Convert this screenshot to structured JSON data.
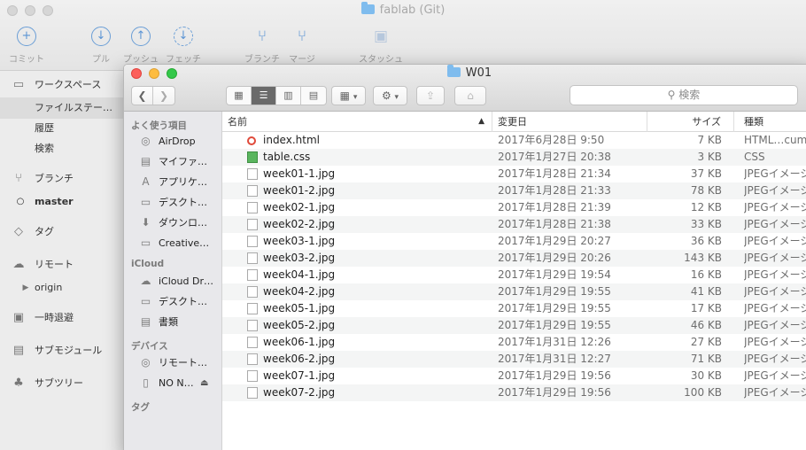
{
  "back_window": {
    "title": "fablab (Git)",
    "toolbar": [
      {
        "label": "コミット",
        "glyph": "+",
        "style": "circ"
      },
      {
        "label": "プル",
        "glyph": "↓",
        "style": "circ"
      },
      {
        "label": "プッシュ",
        "glyph": "↑",
        "style": "circ"
      },
      {
        "label": "フェッチ",
        "glyph": "↓",
        "style": "dash"
      },
      {
        "label": "ブランチ",
        "glyph": "⑂",
        "style": "glyph"
      },
      {
        "label": "マージ",
        "glyph": "⑂",
        "style": "glyph"
      },
      {
        "label": "スタッシュ",
        "glyph": "▣",
        "style": "dim"
      }
    ],
    "sidebar": {
      "workspace": "ワークスペース",
      "file_status": "ファイルステー…",
      "history": "履歴",
      "search": "検索",
      "branches": "ブランチ",
      "master": "master",
      "tags": "タグ",
      "remotes": "リモート",
      "origin": "origin",
      "stashes": "一時退避",
      "submodules": "サブモジュール",
      "subtrees": "サブツリー"
    }
  },
  "finder": {
    "title": "W01",
    "search_placeholder": "検索",
    "sidebar": {
      "favorites_header": "よく使う項目",
      "favorites": [
        {
          "label": "AirDrop",
          "icon": "airdrop-icon",
          "glyph": "◎"
        },
        {
          "label": "マイファ…",
          "icon": "all-files-icon",
          "glyph": "▤"
        },
        {
          "label": "アプリケ…",
          "icon": "applications-icon",
          "glyph": "A"
        },
        {
          "label": "デスクト…",
          "icon": "desktop-icon",
          "glyph": "▭"
        },
        {
          "label": "ダウンロ…",
          "icon": "downloads-icon",
          "glyph": "⬇"
        },
        {
          "label": "Creative…",
          "icon": "folder-icon",
          "glyph": "▭"
        }
      ],
      "icloud_header": "iCloud",
      "icloud": [
        {
          "label": "iCloud Dr…",
          "icon": "cloud-icon",
          "glyph": "☁"
        },
        {
          "label": "デスクト…",
          "icon": "desktop-icon",
          "glyph": "▭"
        },
        {
          "label": "書類",
          "icon": "documents-icon",
          "glyph": "▤"
        }
      ],
      "devices_header": "デバイス",
      "devices": [
        {
          "label": "リモート…",
          "icon": "remote-disc-icon",
          "glyph": "◎"
        },
        {
          "label": "NO N…",
          "icon": "drive-icon",
          "glyph": "▯"
        }
      ],
      "tags_header": "タグ"
    },
    "columns": {
      "name": "名前",
      "modified": "変更日",
      "size": "サイズ",
      "kind": "種類"
    },
    "files": [
      {
        "name": "index.html",
        "modified": "2017年6月28日 9:50",
        "size": "7 KB",
        "kind": "HTML…cument"
      },
      {
        "name": "table.css",
        "modified": "2017年1月27日 20:38",
        "size": "3 KB",
        "kind": "CSS"
      },
      {
        "name": "week01-1.jpg",
        "modified": "2017年1月28日 21:34",
        "size": "37 KB",
        "kind": "JPEGイメージ"
      },
      {
        "name": "week01-2.jpg",
        "modified": "2017年1月28日 21:33",
        "size": "78 KB",
        "kind": "JPEGイメージ"
      },
      {
        "name": "week02-1.jpg",
        "modified": "2017年1月28日 21:39",
        "size": "12 KB",
        "kind": "JPEGイメージ"
      },
      {
        "name": "week02-2.jpg",
        "modified": "2017年1月28日 21:38",
        "size": "33 KB",
        "kind": "JPEGイメージ"
      },
      {
        "name": "week03-1.jpg",
        "modified": "2017年1月29日 20:27",
        "size": "36 KB",
        "kind": "JPEGイメージ"
      },
      {
        "name": "week03-2.jpg",
        "modified": "2017年1月29日 20:26",
        "size": "143 KB",
        "kind": "JPEGイメージ"
      },
      {
        "name": "week04-1.jpg",
        "modified": "2017年1月29日 19:54",
        "size": "16 KB",
        "kind": "JPEGイメージ"
      },
      {
        "name": "week04-2.jpg",
        "modified": "2017年1月29日 19:55",
        "size": "41 KB",
        "kind": "JPEGイメージ"
      },
      {
        "name": "week05-1.jpg",
        "modified": "2017年1月29日 19:55",
        "size": "17 KB",
        "kind": "JPEGイメージ"
      },
      {
        "name": "week05-2.jpg",
        "modified": "2017年1月29日 19:55",
        "size": "46 KB",
        "kind": "JPEGイメージ"
      },
      {
        "name": "week06-1.jpg",
        "modified": "2017年1月31日 12:26",
        "size": "27 KB",
        "kind": "JPEGイメージ"
      },
      {
        "name": "week06-2.jpg",
        "modified": "2017年1月31日 12:27",
        "size": "71 KB",
        "kind": "JPEGイメージ"
      },
      {
        "name": "week07-1.jpg",
        "modified": "2017年1月29日 19:56",
        "size": "30 KB",
        "kind": "JPEGイメージ"
      },
      {
        "name": "week07-2.jpg",
        "modified": "2017年1月29日 19:56",
        "size": "100 KB",
        "kind": "JPEGイメージ"
      }
    ]
  }
}
